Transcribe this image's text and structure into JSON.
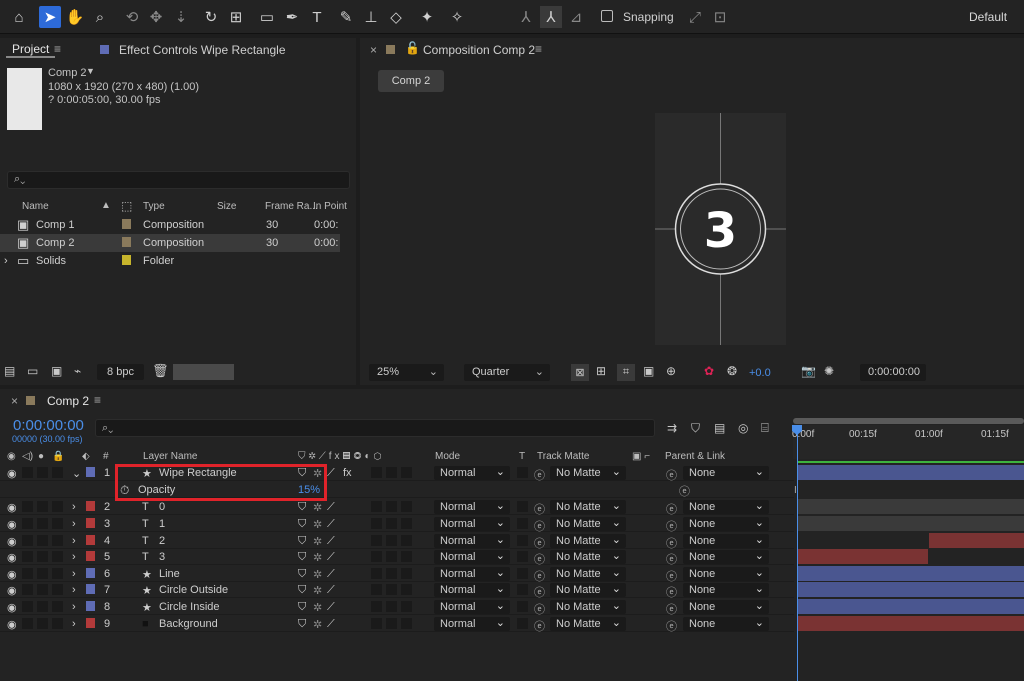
{
  "toolbar": {
    "snapping_label": "Snapping",
    "workspace_label": "Default"
  },
  "project": {
    "tab_label": "Project",
    "effect_controls_label": "Effect Controls Wipe Rectangle",
    "comp_name": "Comp 2",
    "comp_dims": "1080 x 1920  (270 x 480) (1.00)",
    "comp_duration": "? 0:00:05:00, 30.00 fps",
    "columns": {
      "name": "Name",
      "type": "Type",
      "size": "Size",
      "frame_rate": "Frame Ra...",
      "in_point": "In Point"
    },
    "items": [
      {
        "name": "Comp 1",
        "type": "Composition",
        "frame_rate": "30",
        "in_point": "0:00:",
        "color": "#8a7a5c"
      },
      {
        "name": "Comp 2",
        "type": "Composition",
        "frame_rate": "30",
        "in_point": "0:00:",
        "color": "#8a7a5c"
      },
      {
        "name": "Solids",
        "type": "Folder",
        "frame_rate": "",
        "in_point": "",
        "color": "#c7b52c"
      }
    ],
    "bpc_label": "8 bpc"
  },
  "viewer": {
    "tab_label": "Composition Comp 2",
    "comp_chip": "Comp 2",
    "countdown_digit": "3",
    "zoom": "25%",
    "resolution": "Quarter",
    "exposure": "+0.0",
    "timecode": "0:00:00:00"
  },
  "timeline": {
    "tab_label": "Comp 2",
    "timecode": "0:00:00:00",
    "timecode_sub": "00000 (30.00 fps)",
    "columns": {
      "layer_name": "Layer Name",
      "mode": "Mode",
      "t": "T",
      "track_matte": "Track Matte",
      "parent_link": "Parent & Link",
      "hash": "#"
    },
    "ruler": [
      "0:00f",
      "00:15f",
      "01:00f",
      "01:15f"
    ],
    "opacity_label": "Opacity",
    "opacity_value": "15%",
    "layers": [
      {
        "num": "1",
        "name": "Wipe Rectangle",
        "kind": "shape",
        "mode": "Normal",
        "matte": "No Matte",
        "parent": "None",
        "color": "#5f6cb5"
      },
      {
        "num": "2",
        "name": "0",
        "kind": "text",
        "mode": "Normal",
        "matte": "No Matte",
        "parent": "None",
        "color": "#b33a3a"
      },
      {
        "num": "3",
        "name": "1",
        "kind": "text",
        "mode": "Normal",
        "matte": "No Matte",
        "parent": "None",
        "color": "#b33a3a"
      },
      {
        "num": "4",
        "name": "2",
        "kind": "text",
        "mode": "Normal",
        "matte": "No Matte",
        "parent": "None",
        "color": "#b33a3a"
      },
      {
        "num": "5",
        "name": "3",
        "kind": "text",
        "mode": "Normal",
        "matte": "No Matte",
        "parent": "None",
        "color": "#b33a3a"
      },
      {
        "num": "6",
        "name": "Line",
        "kind": "shape",
        "mode": "Normal",
        "matte": "No Matte",
        "parent": "None",
        "color": "#5f6cb5"
      },
      {
        "num": "7",
        "name": "Circle Outside",
        "kind": "shape",
        "mode": "Normal",
        "matte": "No Matte",
        "parent": "None",
        "color": "#5f6cb5"
      },
      {
        "num": "8",
        "name": "Circle Inside",
        "kind": "shape",
        "mode": "Normal",
        "matte": "No Matte",
        "parent": "None",
        "color": "#5f6cb5"
      },
      {
        "num": "9",
        "name": "Background",
        "kind": "solid",
        "mode": "Normal",
        "matte": "No Matte",
        "parent": "None",
        "color": "#b33a3a"
      }
    ]
  },
  "colors": {
    "accent": "#2d6ad8",
    "timecode": "#4a8ee8",
    "highlight_box": "#e0232a",
    "work_area": "#3db33d"
  }
}
